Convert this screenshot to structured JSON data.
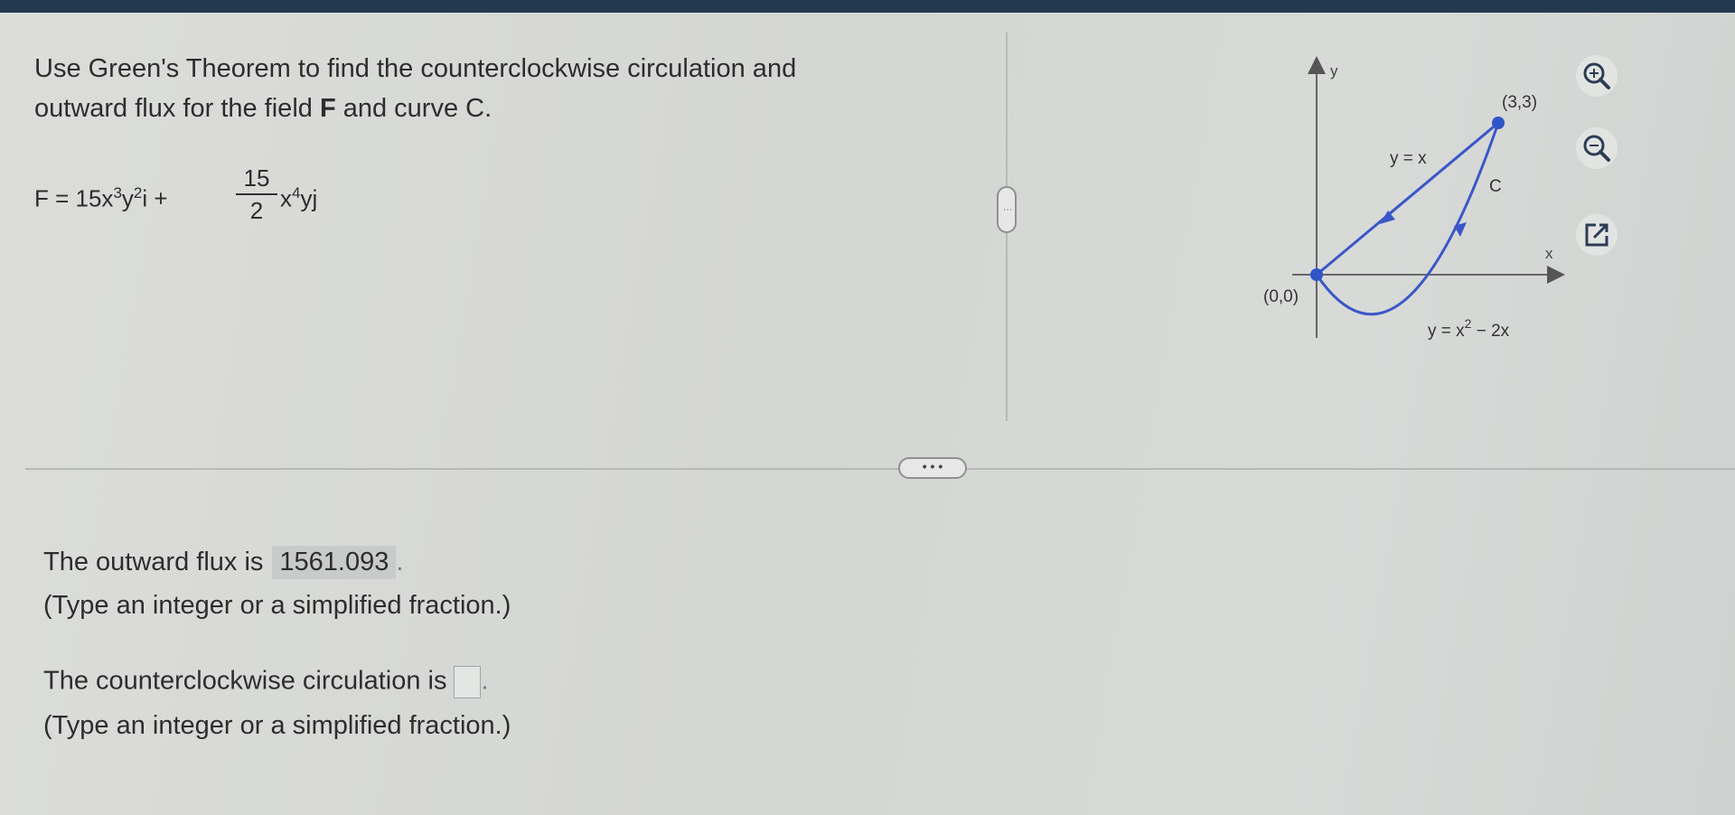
{
  "question": {
    "line1": "Use Green's Theorem to find the counterclockwise circulation and",
    "line2_pre": "outward flux for the field ",
    "line2_bold": "F",
    "line2_post": " and curve C."
  },
  "formula": {
    "lhs": "F = 15x",
    "exp1": "3",
    "y": "y",
    "exp2": "2",
    "i_plus": "i +",
    "numerator": "15",
    "denominator": "2",
    "x": "x",
    "exp3": "4",
    "yj": "yj"
  },
  "graph": {
    "y_axis_label": "y",
    "x_axis_label": "x",
    "point_top": "(3,3)",
    "point_origin": "(0,0)",
    "line_label": "y = x",
    "curve_name": "C",
    "parabola_label_pre": "y = x",
    "parabola_exp": "2",
    "parabola_label_post": " − 2x",
    "curve_color": "#3a57c8",
    "point_color": "#2f55c9"
  },
  "tools": {
    "zoom_in": "zoom-in-icon",
    "zoom_out": "zoom-out-icon",
    "popout": "popout-icon"
  },
  "answers": {
    "flux_label": "The outward flux is",
    "flux_value": "1561.093",
    "flux_period": ".",
    "flux_hint": "(Type an integer or a simplified fraction.)",
    "circ_label": "The counterclockwise circulation is",
    "circ_period": ".",
    "circ_hint": "(Type an integer or a simplified fraction.)"
  },
  "handles": {
    "vertical": "⋮",
    "horizontal": "• • •"
  }
}
